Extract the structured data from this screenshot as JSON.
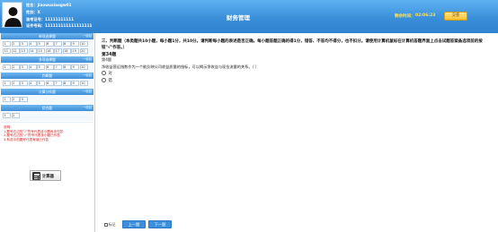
{
  "header": {
    "name_label": "姓名：",
    "name_value": "jiaowuxiaogw01",
    "gender_label": "性别：",
    "gender_value": "X",
    "admission_label": "准考证号：",
    "admission_value": "11111111111",
    "id_label": "证件号码：",
    "id_value": "111111111111111111",
    "title": "财务管理",
    "timer_label": "剩余时间：",
    "timer_value": "02:06:23",
    "submit_label": "交卷"
  },
  "sidebar": {
    "sections": [
      {
        "title": "单项选择题",
        "collapse": "一收起",
        "rows": [
          [
            "1",
            "2",
            "3",
            "4",
            "5",
            "6",
            "7",
            "8",
            "9",
            "10"
          ],
          [
            "11",
            "12",
            "13",
            "14",
            "15",
            "16",
            "17",
            "18",
            "19",
            "20"
          ]
        ]
      },
      {
        "title": "多项选择题",
        "collapse": "一收起",
        "rows": [
          [
            "1",
            "2",
            "3",
            "4",
            "5",
            "6",
            "7",
            "8",
            "9",
            "10"
          ]
        ]
      },
      {
        "title": "判断题",
        "collapse": "一收起",
        "rows": [
          [
            "1",
            "2",
            "3",
            "4",
            "5",
            "6",
            "7",
            "8",
            "9",
            "10"
          ]
        ]
      },
      {
        "title": "计算分析题",
        "collapse": "一收起",
        "rows": [
          [
            "1",
            "2",
            "3"
          ]
        ]
      },
      {
        "title": "综合题",
        "collapse": "一收起",
        "rows": [
          [
            "1",
            "2"
          ]
        ]
      }
    ],
    "notes": [
      "说明：",
      "1.题号右边的\"?\"符号代表该小题尚未作答",
      "2.题号右边的\"√\"符号代表该小题已作答",
      "3.有选中的题号代表有误已作答"
    ],
    "calculator_label": "计算器"
  },
  "main": {
    "instruction": "三、判断题（本类题共10小题，每小题1分，共10分。请判断每小题的表述是否正确。每小题答题正确的得1分，错答、不答均不得分，也不扣分。请使用计算机鼠标在计算机答题界面上点击试题答案备选项前的按钮\"√\"作答。）",
    "question_number": "第34题",
    "question_count": "第4题",
    "stem": "净收益营运指数作为一个能反映公司收益质量的指标，可以揭示净收益与现金流量的关系。（   ）",
    "options": [
      "对",
      "错"
    ],
    "mark_label": "标记",
    "prev_label": "上一题",
    "next_label": "下一题"
  },
  "colors": {
    "header_blue": "#3a8fd9",
    "timer_yellow": "#ffe25a",
    "submit_gold": "#f8c131",
    "note_red": "#d81a1a",
    "nav_blue": "#3c8fdc"
  },
  "icons": [
    "avatar-placeholder-icon",
    "calculator-icon"
  ]
}
